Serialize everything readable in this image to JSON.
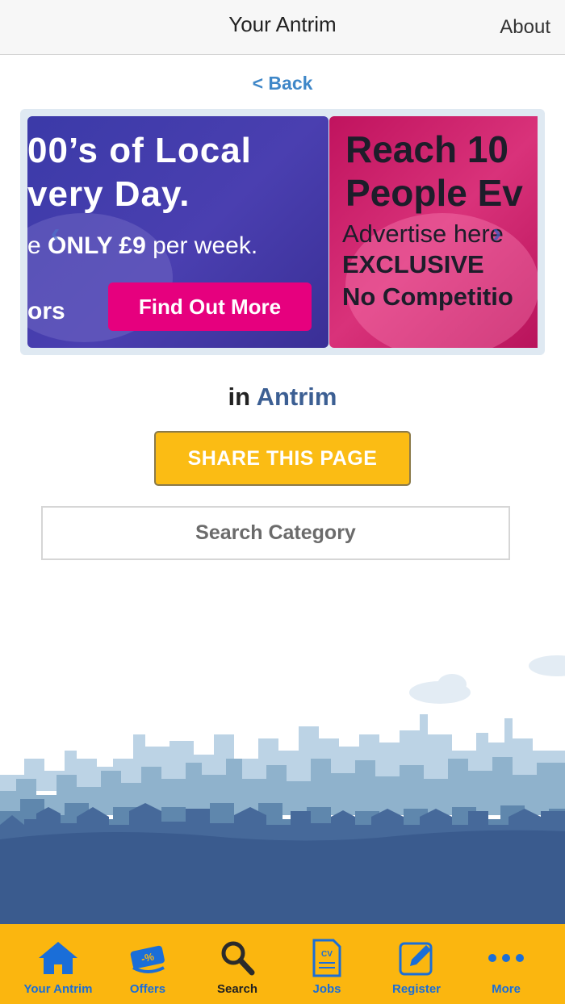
{
  "header": {
    "title": "Your Antrim",
    "about_label": "About"
  },
  "back_label": "< Back",
  "carousel": {
    "slides": [
      {
        "line1": "00’s of Local",
        "line2": "very Day.",
        "line3_pre": "e ",
        "line3_bold": "ONLY £9",
        "line3_post": " per week.",
        "line4": "ors",
        "cta": "Find Out More"
      },
      {
        "line1": "Reach 10",
        "line2": "People Ev",
        "line3": "Advertise here",
        "line4": "EXCLUSIVE",
        "line5": "No Competitio"
      }
    ]
  },
  "location": {
    "prefix": "in",
    "name": "Antrim"
  },
  "share_label": "SHARE THIS PAGE",
  "search": {
    "placeholder": "Search Category"
  },
  "tabs": [
    {
      "label": "Your Antrim",
      "icon": "home-icon"
    },
    {
      "label": "Offers",
      "icon": "offers-icon"
    },
    {
      "label": "Search",
      "icon": "search-icon"
    },
    {
      "label": "Jobs",
      "icon": "cv-icon"
    },
    {
      "label": "Register",
      "icon": "edit-icon"
    },
    {
      "label": "More",
      "icon": "more-icon"
    }
  ],
  "colors": {
    "accent": "#fbb60f",
    "tab_label": "#1a6ed8",
    "link": "#3f87c8",
    "location": "#3c5f93"
  }
}
